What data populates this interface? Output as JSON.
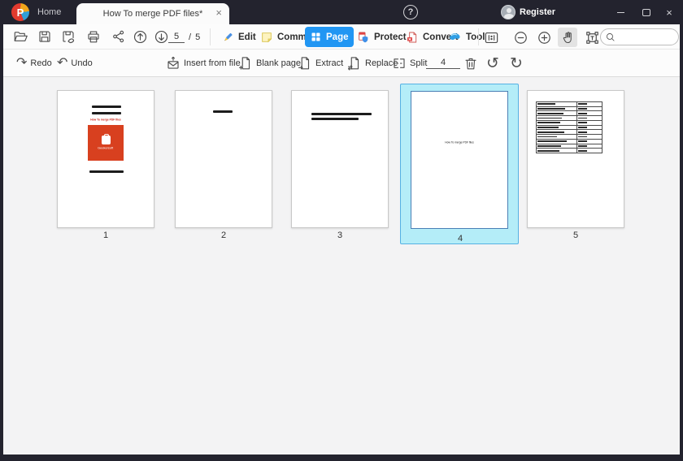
{
  "titlebar": {
    "logo_letter": "P",
    "home_label": "Home",
    "tab_title": "How To merge PDF files*",
    "tab_close": "×",
    "help_label": "?",
    "register_label": "Register",
    "window_close": "×"
  },
  "toolbar": {
    "page_current": "5",
    "page_separator": "/",
    "page_total": "5",
    "tabs": {
      "edit": "Edit",
      "comment": "Comment",
      "page": "Page",
      "protect": "Protect",
      "convert": "Convert",
      "tool": "Tool"
    },
    "active_tab": "Page",
    "search_placeholder": ""
  },
  "actions": {
    "redo": "Redo",
    "undo": "Undo",
    "insert_from_file": "Insert from file",
    "blank_page": "Blank page",
    "extract": "Extract",
    "replace": "Replace",
    "split": "Split",
    "split_pages_value": "4"
  },
  "glyphs": {
    "redo": "↷",
    "undo": "↶",
    "rotate_left": "↺",
    "rotate_right": "↻"
  },
  "thumbnails": {
    "selected_page": 4,
    "pages": [
      {
        "number": "1"
      },
      {
        "number": "2"
      },
      {
        "number": "3"
      },
      {
        "number": "4"
      },
      {
        "number": "5"
      }
    ],
    "page1": {
      "logo_text": "Geekersoft",
      "red_text": "How To merge PDF files"
    },
    "page4": {
      "center_text": "How To merge PDF files"
    },
    "page5_table": {
      "rows": 11,
      "col1_width_pct": 62,
      "col2_bar_pct": 38,
      "col1_bars_pct": [
        46,
        72,
        68,
        62,
        58,
        54,
        70,
        50,
        76,
        60,
        56
      ]
    }
  },
  "colors": {
    "titlebar_bg": "#23232e",
    "accent_blue": "#2196f3",
    "selection_fill": "#b4edf8",
    "selection_border": "#55b1e3",
    "logo_red": "#d8401f"
  }
}
